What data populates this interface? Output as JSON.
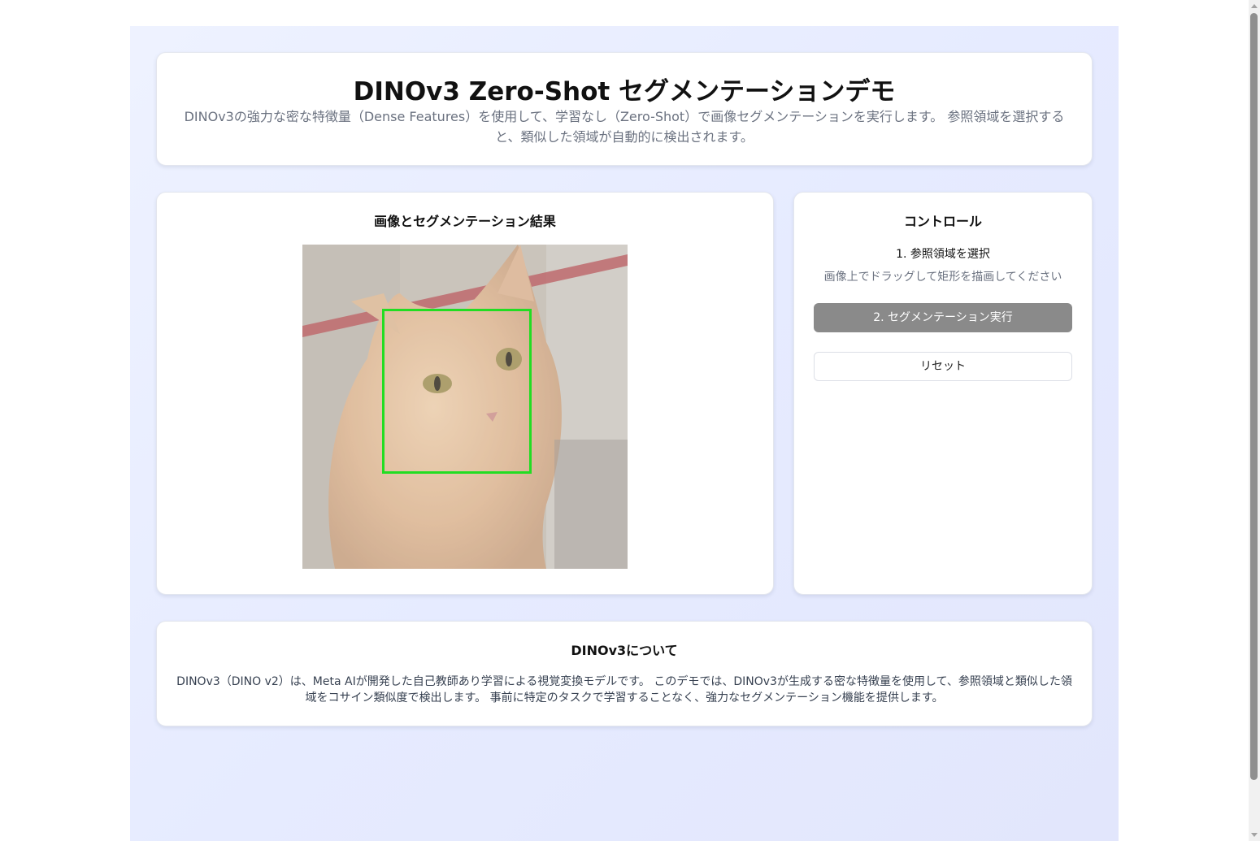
{
  "header": {
    "title": "DINOv3 Zero-Shot セグメンテーションデモ",
    "description": "DINOv3の強力な密な特徴量（Dense Features）を使用して、学習なし（Zero-Shot）で画像セグメンテーションを実行します。 参照領域を選択すると、類似した領域が自動的に検出されます。"
  },
  "image_panel": {
    "title": "画像とセグメンテーション結果"
  },
  "controls": {
    "title": "コントロール",
    "step1_label": "1. 参照領域を選択",
    "step1_hint": "画像上でドラッグして矩形を描画してください",
    "run_button": "2. セグメンテーション実行",
    "reset_button": "リセット"
  },
  "about": {
    "title": "DINOv3について",
    "text": "DINOv3（DINO v2）は、Meta AIが開発した自己教師あり学習による視覚変換モデルです。 このデモでは、DINOv3が生成する密な特徴量を使用して、参照領域と類似した領域をコサイン類似度で検出します。 事前に特定のタスクで学習することなく、強力なセグメンテーション機能を提供します。"
  },
  "colors": {
    "selection_box": "#22dd22",
    "run_button_bg": "#8a8a8a",
    "page_bg": "#e8edff"
  }
}
